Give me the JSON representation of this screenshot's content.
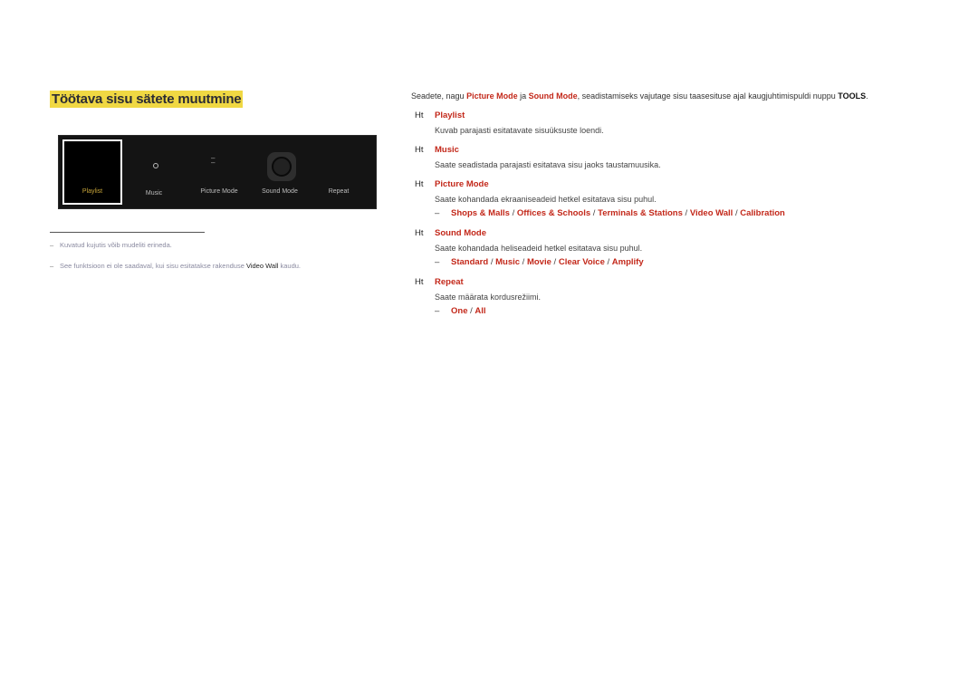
{
  "heading": "Töötava sisu sätete muutmine",
  "panel": {
    "items": [
      "Playlist",
      "Music",
      "Picture Mode",
      "Sound Mode",
      "Repeat"
    ],
    "selected": "Playlist",
    "selected_color": "#c9a63a"
  },
  "notes": [
    {
      "text": "Kuvatud kujutis võib mudeliti erineda."
    },
    {
      "pre": "See funktsioon ei ole saadaval, kui sisu esitatakse rakenduse ",
      "bold": "Video Wall",
      "post": " kaudu."
    }
  ],
  "intro": {
    "t1": "Seadete, nagu ",
    "b1": "Picture Mode",
    "t2": " ja ",
    "b2": "Sound Mode",
    "t3": ", seadistamiseks vajutage sisu taasesituse ajal kaugjuhtimispuldi nuppu ",
    "b3": "TOOLS",
    "t4": "."
  },
  "marker": "Ht",
  "dash": "–",
  "sep": " / ",
  "sections": [
    {
      "title": "Playlist",
      "desc": "Kuvab parajasti esitatavate sisuüksuste loendi.",
      "options": []
    },
    {
      "title": "Music",
      "desc": "Saate seadistada parajasti esitatava sisu jaoks taustamuusika.",
      "options": []
    },
    {
      "title": "Picture Mode",
      "desc": "Saate kohandada ekraaniseadeid hetkel esitatava sisu puhul.",
      "options": [
        "Shops & Malls",
        "Offices & Schools",
        "Terminals & Stations",
        "Video Wall",
        "Calibration"
      ]
    },
    {
      "title": "Sound Mode",
      "desc": "Saate kohandada heliseadeid hetkel esitatava sisu puhul.",
      "options": [
        "Standard",
        "Music",
        "Movie",
        "Clear Voice",
        "Amplify"
      ]
    },
    {
      "title": "Repeat",
      "desc": "Saate määrata kordusrežiimi.",
      "options": [
        "One",
        "All"
      ]
    }
  ],
  "colors": {
    "accent": "#c3281a",
    "highlight": "#f0d843"
  }
}
